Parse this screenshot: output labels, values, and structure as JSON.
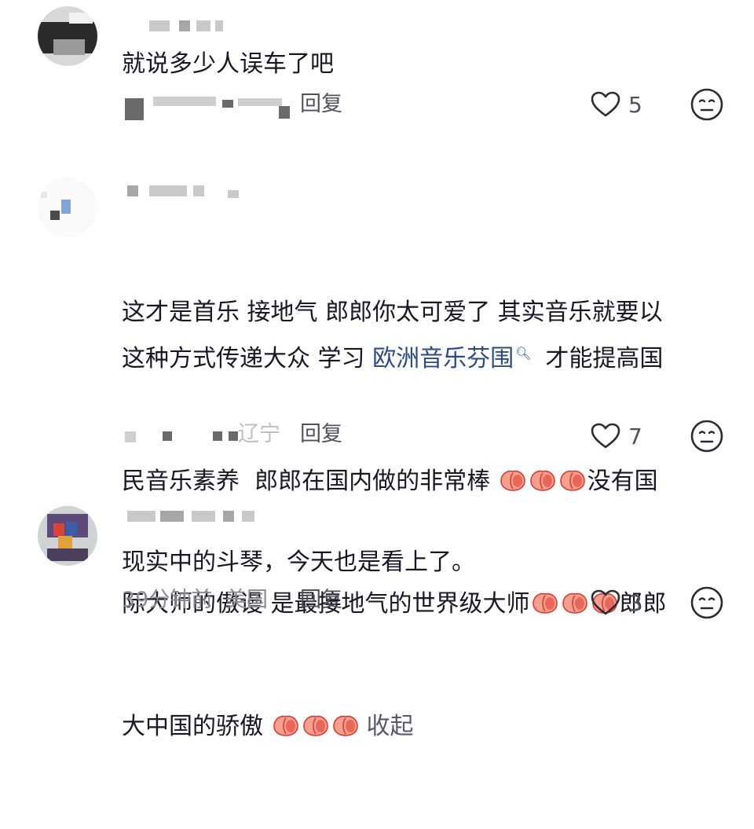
{
  "comments": [
    {
      "text": "就说多少人误车了吧",
      "reply_label": "回复",
      "like_count": "5"
    },
    {
      "text_before": "这才是首乐 接地气 郎郎你太可爱了 其实音乐就要以\n这种方式传递大众 学习 ",
      "link": "欧洲音乐芬围",
      "line3": "才能提高国",
      "line4": "民音乐素养  郎郎在国内做的非常棒 ",
      "line4_end": "没有国",
      "line5": "际大师的傲谩 是最接地气的世界级大师",
      "line5_end": "郎郎",
      "line6": "大中国的骄傲 ",
      "collapse_label": "收起",
      "location": "辽宁",
      "reply_label": "回复",
      "like_count": "7"
    },
    {
      "text": "现实中的斗琴，今天也是看上了。",
      "time": "39分钟前",
      "location": "美国",
      "reply_label": "回复",
      "like_count": "3"
    }
  ],
  "icons": {
    "like": "heart-outline-icon",
    "dislike": "meh-face-icon",
    "emoji": "peach-emoji-icon",
    "search": "search-icon"
  },
  "colors": {
    "text": "#161823",
    "meta": "#8a8b91",
    "link": "#2a4a8a",
    "emoji_fill": "#f2a08f",
    "emoji_core": "#e2382f"
  }
}
